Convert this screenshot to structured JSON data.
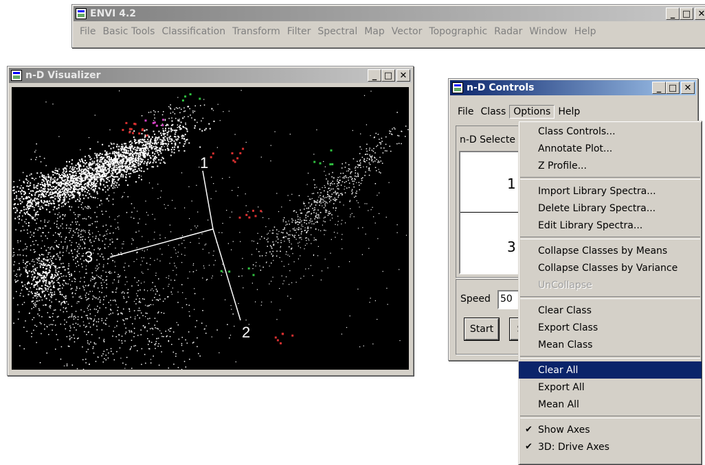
{
  "envi_window": {
    "title": "ENVI 4.2",
    "menu": [
      "File",
      "Basic Tools",
      "Classification",
      "Transform",
      "Filter",
      "Spectral",
      "Map",
      "Vector",
      "Topographic",
      "Radar",
      "Window",
      "Help"
    ],
    "buttons": {
      "minimize": "_",
      "maximize": "□",
      "close": "✕"
    }
  },
  "visualizer": {
    "title": "n-D Visualizer",
    "axis_labels": [
      "1",
      "2",
      "3"
    ],
    "buttons": {
      "minimize": "_",
      "maximize": "□",
      "close": "✕"
    }
  },
  "controls": {
    "title": "n-D Controls",
    "menu": [
      "File",
      "Class",
      "Options",
      "Help"
    ],
    "active_menu": "Options",
    "selected_label": "n-D Selecte",
    "band_numbers": [
      "1",
      "3"
    ],
    "speed_label": "Speed",
    "speed_value": "50",
    "start_button": "Start",
    "second_button_partial": "S",
    "buttons": {
      "minimize": "_",
      "maximize": "□",
      "close": "✕"
    }
  },
  "options_menu": {
    "groups": [
      [
        "Class Controls...",
        "Annotate Plot...",
        "Z Profile..."
      ],
      [
        "Import Library Spectra...",
        "Delete Library Spectra...",
        "Edit Library Spectra..."
      ],
      [
        "Collapse Classes by Means",
        "Collapse Classes by Variance",
        "UnCollapse"
      ],
      [
        "Clear Class",
        "Export Class",
        "Mean Class"
      ],
      [
        "Clear All",
        "Export All",
        "Mean All"
      ],
      [
        "Show Axes",
        "3D: Drive Axes"
      ]
    ],
    "selected_item": "Clear All",
    "disabled_items": [
      "UnCollapse"
    ],
    "checked_items": [
      "Show Axes",
      "3D: Drive Axes"
    ]
  },
  "colors": {
    "active_title": "#0a246a",
    "inactive_title": "#808080",
    "plot_background": "#000000",
    "point_color": "#ffffff",
    "class_red": "#d83030",
    "class_green": "#30c040",
    "class_magenta": "#d040c0"
  }
}
